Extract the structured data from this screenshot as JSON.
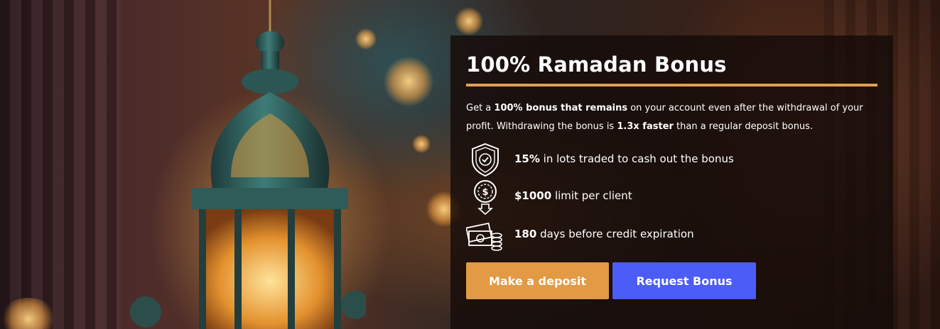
{
  "promo": {
    "title": "100% Ramadan Bonus",
    "description": {
      "part1": "Get a ",
      "bold1": "100% bonus that remains",
      "part2": " on your account even after the withdrawal of your profit. Withdrawing the bonus is ",
      "bold2": "1.3x faster",
      "part3": " than a regular deposit bonus."
    },
    "features": [
      {
        "icon": "shield-check-icon",
        "bold": "15%",
        "text": " in lots traded to cash out the bonus"
      },
      {
        "icon": "dollar-coin-download-icon",
        "bold": "$1000",
        "text": " limit per client"
      },
      {
        "icon": "cash-stack-icon",
        "bold": "180",
        "text": " days before credit expiration"
      }
    ],
    "buttons": {
      "deposit_label": "Make a deposit",
      "bonus_label": "Request Bonus"
    },
    "colors": {
      "accent": "#e0a050",
      "deposit_button": "#e29a45",
      "bonus_button": "#4c5cf6"
    }
  },
  "background": {
    "scene": "ramadan-lantern-illustration"
  }
}
